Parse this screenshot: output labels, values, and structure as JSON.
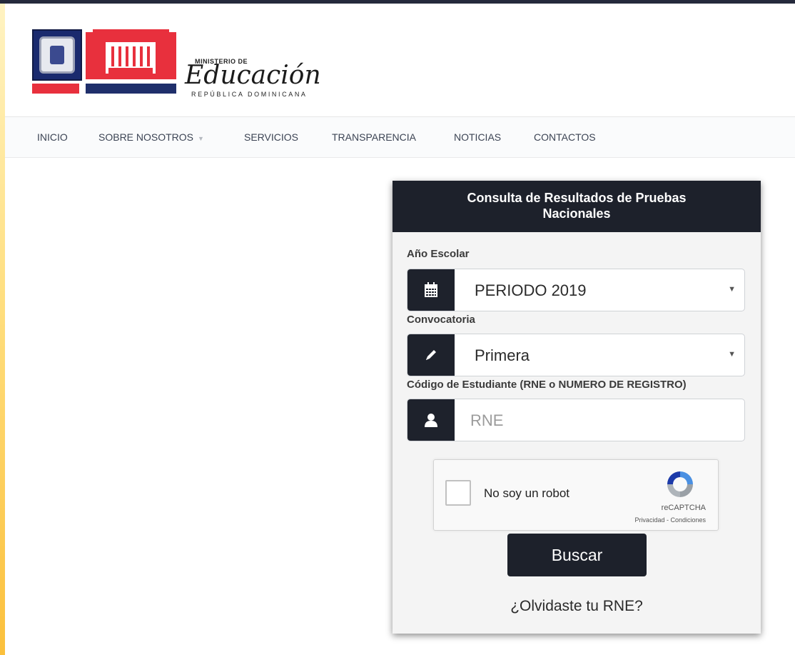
{
  "logo": {
    "ministerio": "MINISTERIO DE",
    "educacion": "Educación",
    "republica": "REPÚBLICA DOMINICANA"
  },
  "nav": {
    "items": [
      "INICIO",
      "SOBRE NOSOTROS",
      "SERVICIOS",
      "TRANSPARENCIA",
      "NOTICIAS",
      "CONTACTOS"
    ]
  },
  "card": {
    "title_line1": "Consulta de Resultados de Pruebas",
    "title_line2": "Nacionales",
    "year_label": "Año Escolar",
    "year_value": "PERIODO 2019",
    "convocatoria_label": "Convocatoria",
    "convocatoria_value": "Primera",
    "student_label": "Código de Estudiante (RNE o NUMERO DE REGISTRO)",
    "student_placeholder": "RNE",
    "captcha": {
      "label": "No soy un robot",
      "brand": "reCAPTCHA",
      "links": "Privacidad - Condiciones"
    },
    "search_button": "Buscar",
    "forgot_link": "¿Olvidaste tu RNE?"
  },
  "colors": {
    "dark": "#1d212b",
    "red": "#e8303d",
    "navy": "#1f2f6b",
    "strip": "#fbc03c"
  },
  "icons": [
    "calendar-icon",
    "pencil-icon",
    "user-icon",
    "recaptcha-icon",
    "chevron-down-icon"
  ]
}
